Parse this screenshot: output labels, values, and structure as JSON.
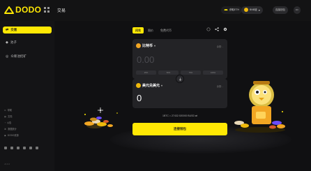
{
  "app": {
    "name": "DODO",
    "page_title": "交易"
  },
  "header": {
    "gas_label": "获取ETH",
    "wallet_label": "连接钱包",
    "network_label": "BNB链",
    "connect_label": "连接钱包",
    "more_label": "•••"
  },
  "sidebar": {
    "items": [
      {
        "label": "交易",
        "icon": "swap-icon",
        "active": true
      },
      {
        "label": "池子",
        "icon": "pool-icon",
        "active": false
      },
      {
        "label": "众筹池挖矿",
        "icon": "mining-icon",
        "active": false
      }
    ],
    "footer_links": [
      "帮助",
      "文档",
      "公告",
      "数据统计",
      "DODO资源"
    ],
    "version": "v3.0.2"
  },
  "swap": {
    "tabs": [
      "闪兑",
      "限价",
      "免费代币"
    ],
    "from_token": "比特币",
    "from_balance": "余额: -",
    "from_amount_placeholder": "0.00",
    "percent_buttons": [
      "25%",
      "50%",
      "75%",
      "100%"
    ],
    "to_token": "美元兑美元",
    "to_balance": "余额: -",
    "to_amount": "0",
    "rate_text": "1BTC = 27432.920000 BUSD",
    "cta_label": "连接钱包"
  },
  "colors": {
    "accent": "#ffe804",
    "background": "#0e0e10",
    "card": "#232326"
  }
}
